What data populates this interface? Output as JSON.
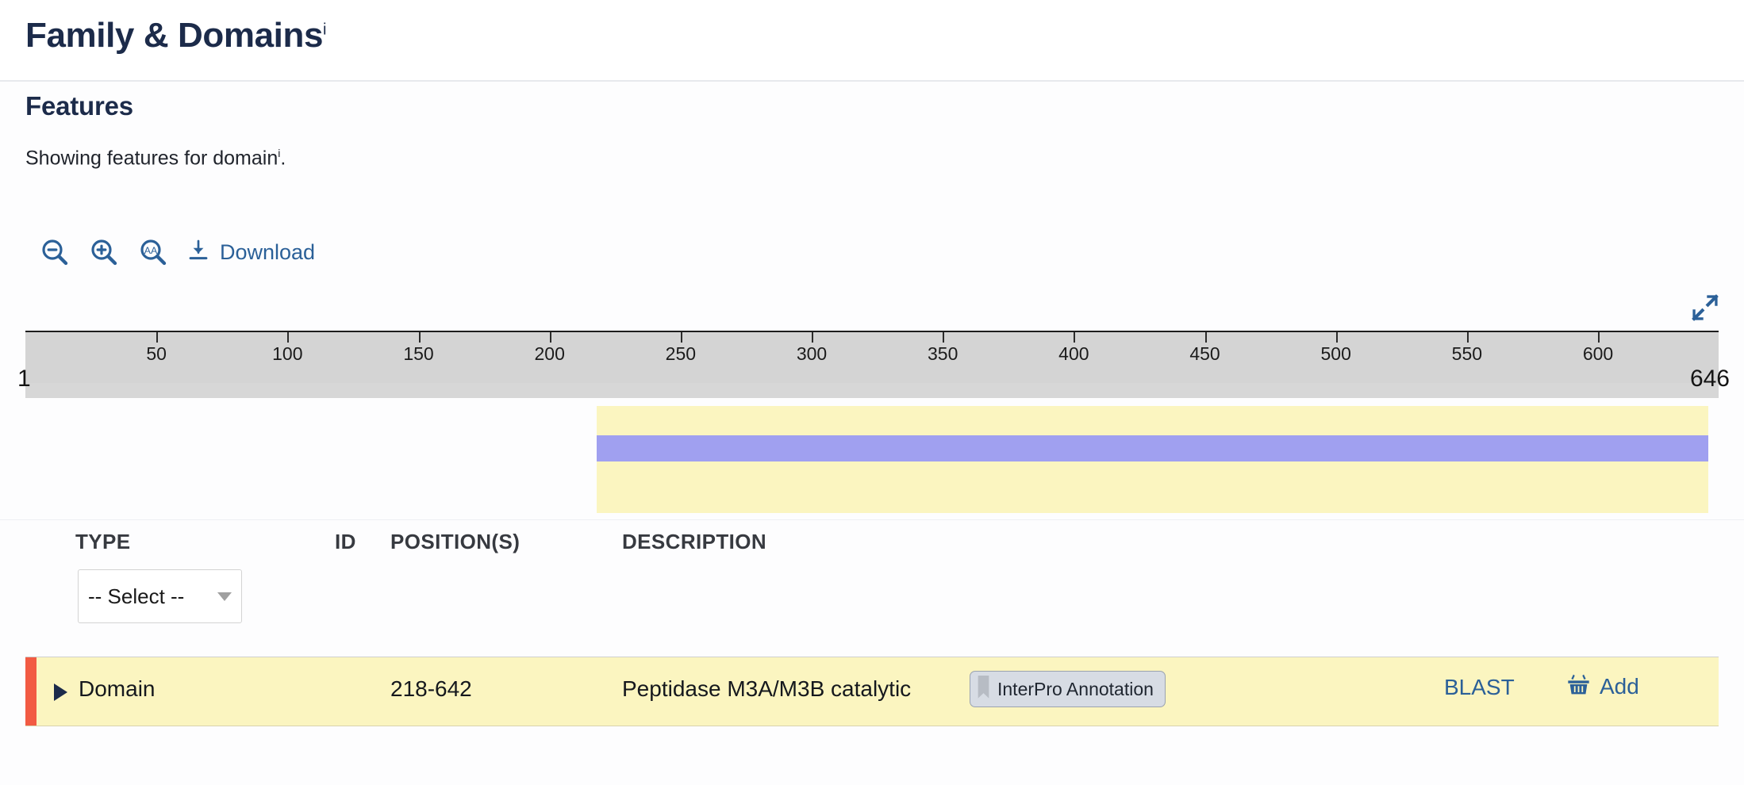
{
  "header": {
    "title": "Family & Domains",
    "info_marker": "i"
  },
  "features": {
    "title": "Features",
    "subtitle_prefix": "Showing features for domain",
    "subtitle_marker": "i",
    "subtitle_suffix": "."
  },
  "toolbar": {
    "zoom_out_icon": "zoom-out-icon",
    "zoom_in_icon": "zoom-in-icon",
    "amino_acid_icon": "amino-acid-zoom-icon",
    "download_icon": "download-icon",
    "download_label": "Download",
    "expand_icon": "expand-fullscreen-icon"
  },
  "ruler": {
    "start": "1",
    "end": "646",
    "ticks": [
      {
        "label": "50",
        "value": 50
      },
      {
        "label": "100",
        "value": 100
      },
      {
        "label": "150",
        "value": 150
      },
      {
        "label": "200",
        "value": 200
      },
      {
        "label": "250",
        "value": 250
      },
      {
        "label": "300",
        "value": 300
      },
      {
        "label": "350",
        "value": 350
      },
      {
        "label": "400",
        "value": 400
      },
      {
        "label": "450",
        "value": 450
      },
      {
        "label": "500",
        "value": 500
      },
      {
        "label": "550",
        "value": 550
      },
      {
        "label": "600",
        "value": 600
      }
    ],
    "sequence_length": 646
  },
  "track": {
    "feature_start": 218,
    "feature_end": 642,
    "highlight_color": "#fbf5c0",
    "bar_color": "#a0a0f0"
  },
  "table": {
    "columns": {
      "type": "TYPE",
      "id": "ID",
      "positions": "POSITION(S)",
      "description": "DESCRIPTION"
    },
    "type_filter": {
      "selected": "-- Select --",
      "options": [
        "-- Select --",
        "Domain"
      ]
    },
    "rows": [
      {
        "type": "Domain",
        "id": "",
        "positions": "218-642",
        "description": "Peptidase M3A/M3B catalytic",
        "badge": "InterPro Annotation",
        "blast_label": "BLAST",
        "add_label": "Add",
        "accent_color": "#f25b43",
        "row_color": "#fbf5c0"
      }
    ]
  },
  "colors": {
    "title": "#1c2b4a",
    "link": "#2b6098",
    "ruler": "#d4d4d4",
    "accent_red": "#f25b43"
  }
}
